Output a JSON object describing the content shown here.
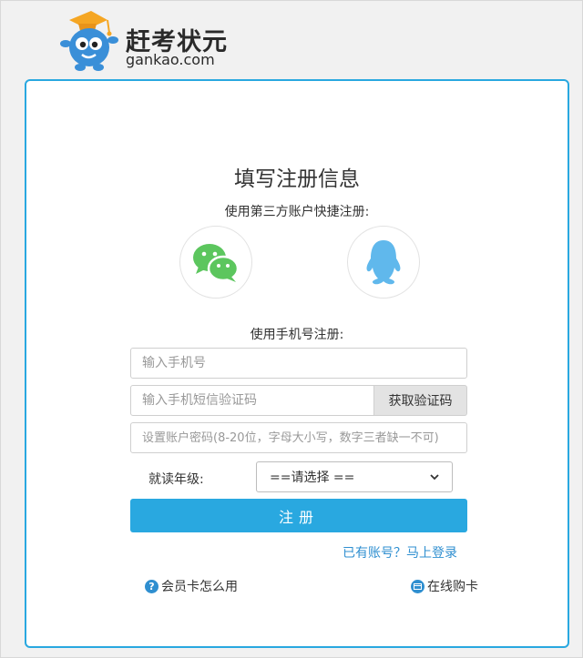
{
  "brand": {
    "name_cn": "赶考状元",
    "domain_text": "gankao.com"
  },
  "form": {
    "title": "填写注册信息",
    "third_party_label": "使用第三方账户快捷注册:",
    "phone_section_label": "使用手机号注册:",
    "phone_placeholder": "输入手机号",
    "sms_placeholder": "输入手机短信验证码",
    "sms_button": "获取验证码",
    "password_placeholder": "设置账户密码(8-20位，字母大小写，数字三者缺一不可)",
    "grade_label": "就读年级:",
    "grade_selected": "==请选择 ==",
    "submit_label": "注册",
    "login_link": "已有账号？马上登录"
  },
  "footer": {
    "member_card_help": "会员卡怎么用",
    "buy_card": "在线购卡"
  },
  "icons": {
    "wechat": "wechat-icon",
    "qq": "qq-icon",
    "help": "question-circle-icon",
    "card": "card-icon"
  },
  "colors": {
    "accent": "#29a8e0",
    "link": "#2f8fd0",
    "wechat_green": "#5cc65e",
    "qq_blue": "#60b8ec"
  }
}
